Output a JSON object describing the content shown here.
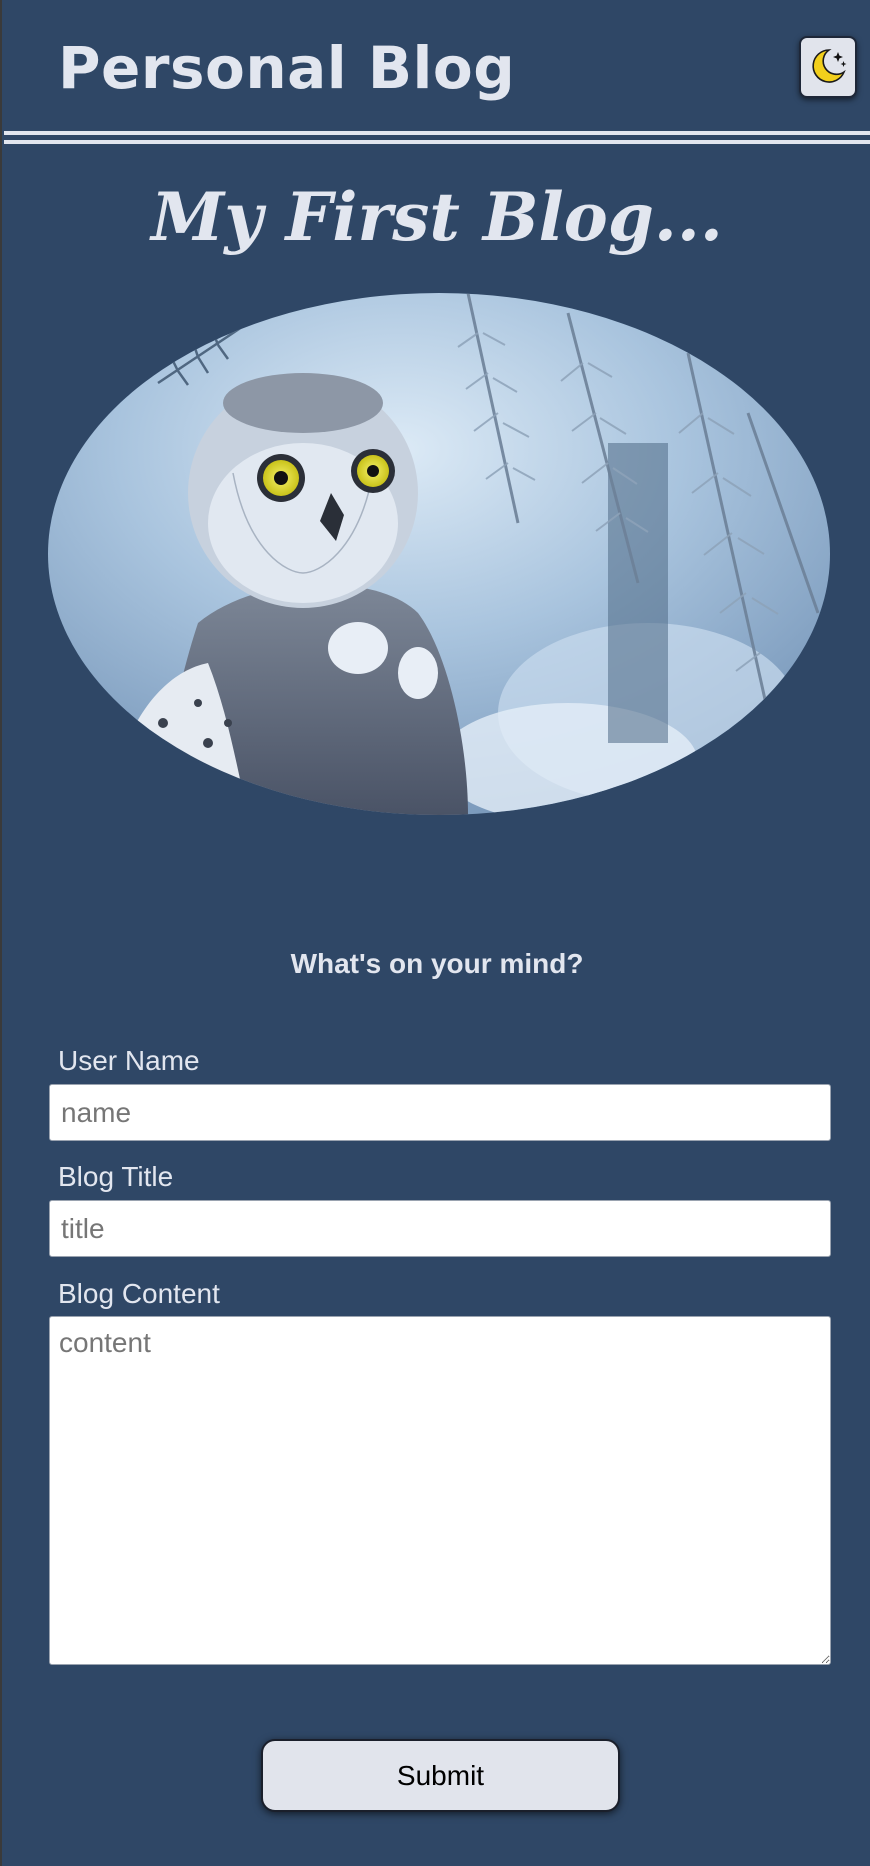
{
  "header": {
    "title": "Personal Blog",
    "theme_toggle_icon": "moon-stars-icon"
  },
  "main": {
    "blog_heading": "My First Blog...",
    "hero_image": "snowy-owl-photo",
    "prompt": "What's on your mind?"
  },
  "form": {
    "username_label": "User Name",
    "username_placeholder": "name",
    "username_value": "",
    "title_label": "Blog Title",
    "title_placeholder": "title",
    "title_value": "",
    "content_label": "Blog Content",
    "content_placeholder": "content",
    "content_value": "",
    "submit_label": "Submit"
  },
  "colors": {
    "background": "#2f4766",
    "text": "#e2e6ef",
    "button": "#e1e4ec",
    "moon": "#f2cf1c"
  }
}
